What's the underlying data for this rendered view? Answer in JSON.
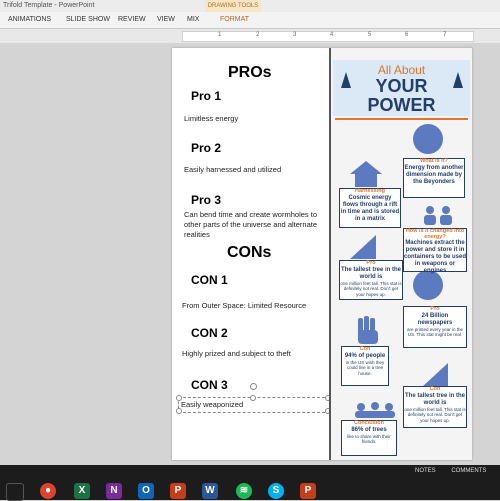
{
  "window": {
    "title": "Trifold Template - PowerPoint"
  },
  "ribbon": {
    "tabs": [
      "ANIMATIONS",
      "SLIDE SHOW",
      "REVIEW",
      "VIEW",
      "MIX",
      "FORMAT"
    ],
    "contextual_group": "DRAWING TOOLS"
  },
  "ruler": {
    "labels": [
      "1",
      "2",
      "3",
      "4",
      "5",
      "6",
      "7"
    ]
  },
  "left_panel": {
    "pros_title": "PROs",
    "pros": [
      {
        "heading": "Pro 1",
        "text": "Limitless energy"
      },
      {
        "heading": "Pro 2",
        "text": "Easily harnessed and utilized"
      },
      {
        "heading": "Pro 3",
        "text": "Can bend time and create wormholes to other parts of the universe and alternate realities"
      }
    ],
    "cons_title": "CONs",
    "cons": [
      {
        "heading": "CON 1",
        "text": "From Outer Space: Limited Resource"
      },
      {
        "heading": "CON 2",
        "text": "Highly prized and subject to theft"
      },
      {
        "heading": "CON 3",
        "text": "Easily weaponized"
      }
    ]
  },
  "right_panel": {
    "banner": {
      "line1": "All About",
      "line2": "YOUR",
      "line3": "POWER"
    },
    "cards": {
      "what": {
        "title": "What is it?",
        "text": "Energy from another dimension made by the Beyonders"
      },
      "harnessing": {
        "title": "Harnessing",
        "text": "Cosmic energy flows through a rift in time and is stored in a matrix"
      },
      "how": {
        "title": "How is it changed into energy?",
        "text": "Machines extract the power and store it in containers to be used in weapons or engines"
      },
      "pro1": {
        "title": "Pro",
        "big": "The tallest tree in the world is",
        "text": "one million feet tall. This stat is definitely not real. Don't get your hopes up."
      },
      "pro2": {
        "title": "Pro",
        "big": "24 Billion newspapers",
        "text": "are printed every year in the US. This stat might be real."
      },
      "con1": {
        "title": "Con",
        "big": "94% of people",
        "text": "in the US wish they could live in a tree house."
      },
      "con2": {
        "title": "Con",
        "big": "The tallest tree in the world is",
        "text": "one million feet tall. This stat is definitely not real. Don't get your hopes up."
      },
      "conclusion": {
        "title": "Conclusion",
        "big": "86% of trees",
        "text": "like to share with their friends."
      }
    }
  },
  "tray": {
    "notes": "NOTES",
    "comments": "COMMENTS"
  },
  "colors": {
    "accent_orange": "#e0762c",
    "navy": "#233e6c",
    "icon_blue": "#5b7ac0",
    "banner_bg": "#dbe8f6"
  }
}
